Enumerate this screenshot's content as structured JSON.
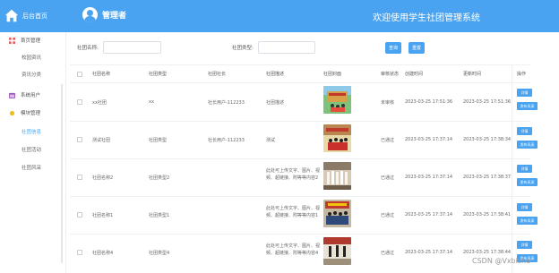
{
  "header": {
    "brand_label": "后台首页",
    "user_name": "管理者",
    "welcome": "欢迎使用学生社团管理系统",
    "background": "#4aa3f0"
  },
  "sidebar": {
    "items": [
      {
        "label": "首页管理",
        "icon": "grid-icon",
        "color": "#e85b5b"
      },
      {
        "label": "校园资讯",
        "sub": true
      },
      {
        "label": "资讯分类",
        "sub": true
      },
      {
        "label": "系统用户",
        "icon": "calendar-icon",
        "color": "#9b59b6"
      },
      {
        "label": "模块管理",
        "icon": "sun-icon",
        "color": "#f0c020"
      },
      {
        "label": "社团信息",
        "sub": true,
        "active": true
      },
      {
        "label": "社团活动",
        "sub": true
      },
      {
        "label": "社团风采",
        "sub": true
      }
    ]
  },
  "search": {
    "name_label": "社团名称:",
    "type_label": "社团类型:",
    "query_button": "查询",
    "reset_button": "重置"
  },
  "table": {
    "headers": [
      "社团名称",
      "社团类型",
      "社团社长",
      "社团描述",
      "社团封面",
      "审核状态",
      "创建时间",
      "更新时间",
      "操作"
    ],
    "rows": [
      {
        "name": "xx社团",
        "type": "xx",
        "leader": "社长用户-112233",
        "desc": "社团描述",
        "status": "未审核",
        "created": "2023-03-25 17:51:36",
        "updated": "2023-03-25 17:51:36"
      },
      {
        "name": "测试社团",
        "type": "社团类型",
        "leader": "社长用户-112233",
        "desc": "测试",
        "status": "已通过",
        "created": "2023-03-25 17:37:14",
        "updated": "2023-03-25 17:38:34"
      },
      {
        "name": "社团名称2",
        "type": "社团类型2",
        "leader": "",
        "desc": "此处可上传文字、图片、视频、超链接、附等等内容2",
        "status": "已通过",
        "created": "2023-03-25 17:37:14",
        "updated": "2023-03-25 17:38:37"
      },
      {
        "name": "社团名称1",
        "type": "社团类型1",
        "leader": "",
        "desc": "此处可上传文字、图片、视频、超链接、附等等内容1",
        "status": "已通过",
        "created": "2023-03-25 17:37:14",
        "updated": "2023-03-25 17:38:41"
      },
      {
        "name": "社团名称4",
        "type": "社团类型4",
        "leader": "",
        "desc": "此处可上传文字、图片、视频、超链接、附等等内容4",
        "status": "已通过",
        "created": "2023-03-25 17:37:14",
        "updated": "2023-03-25 17:38:44"
      }
    ],
    "actions": {
      "detail": "详情",
      "post": "发布风采"
    }
  },
  "watermark": "CSDN @Vxbishe"
}
